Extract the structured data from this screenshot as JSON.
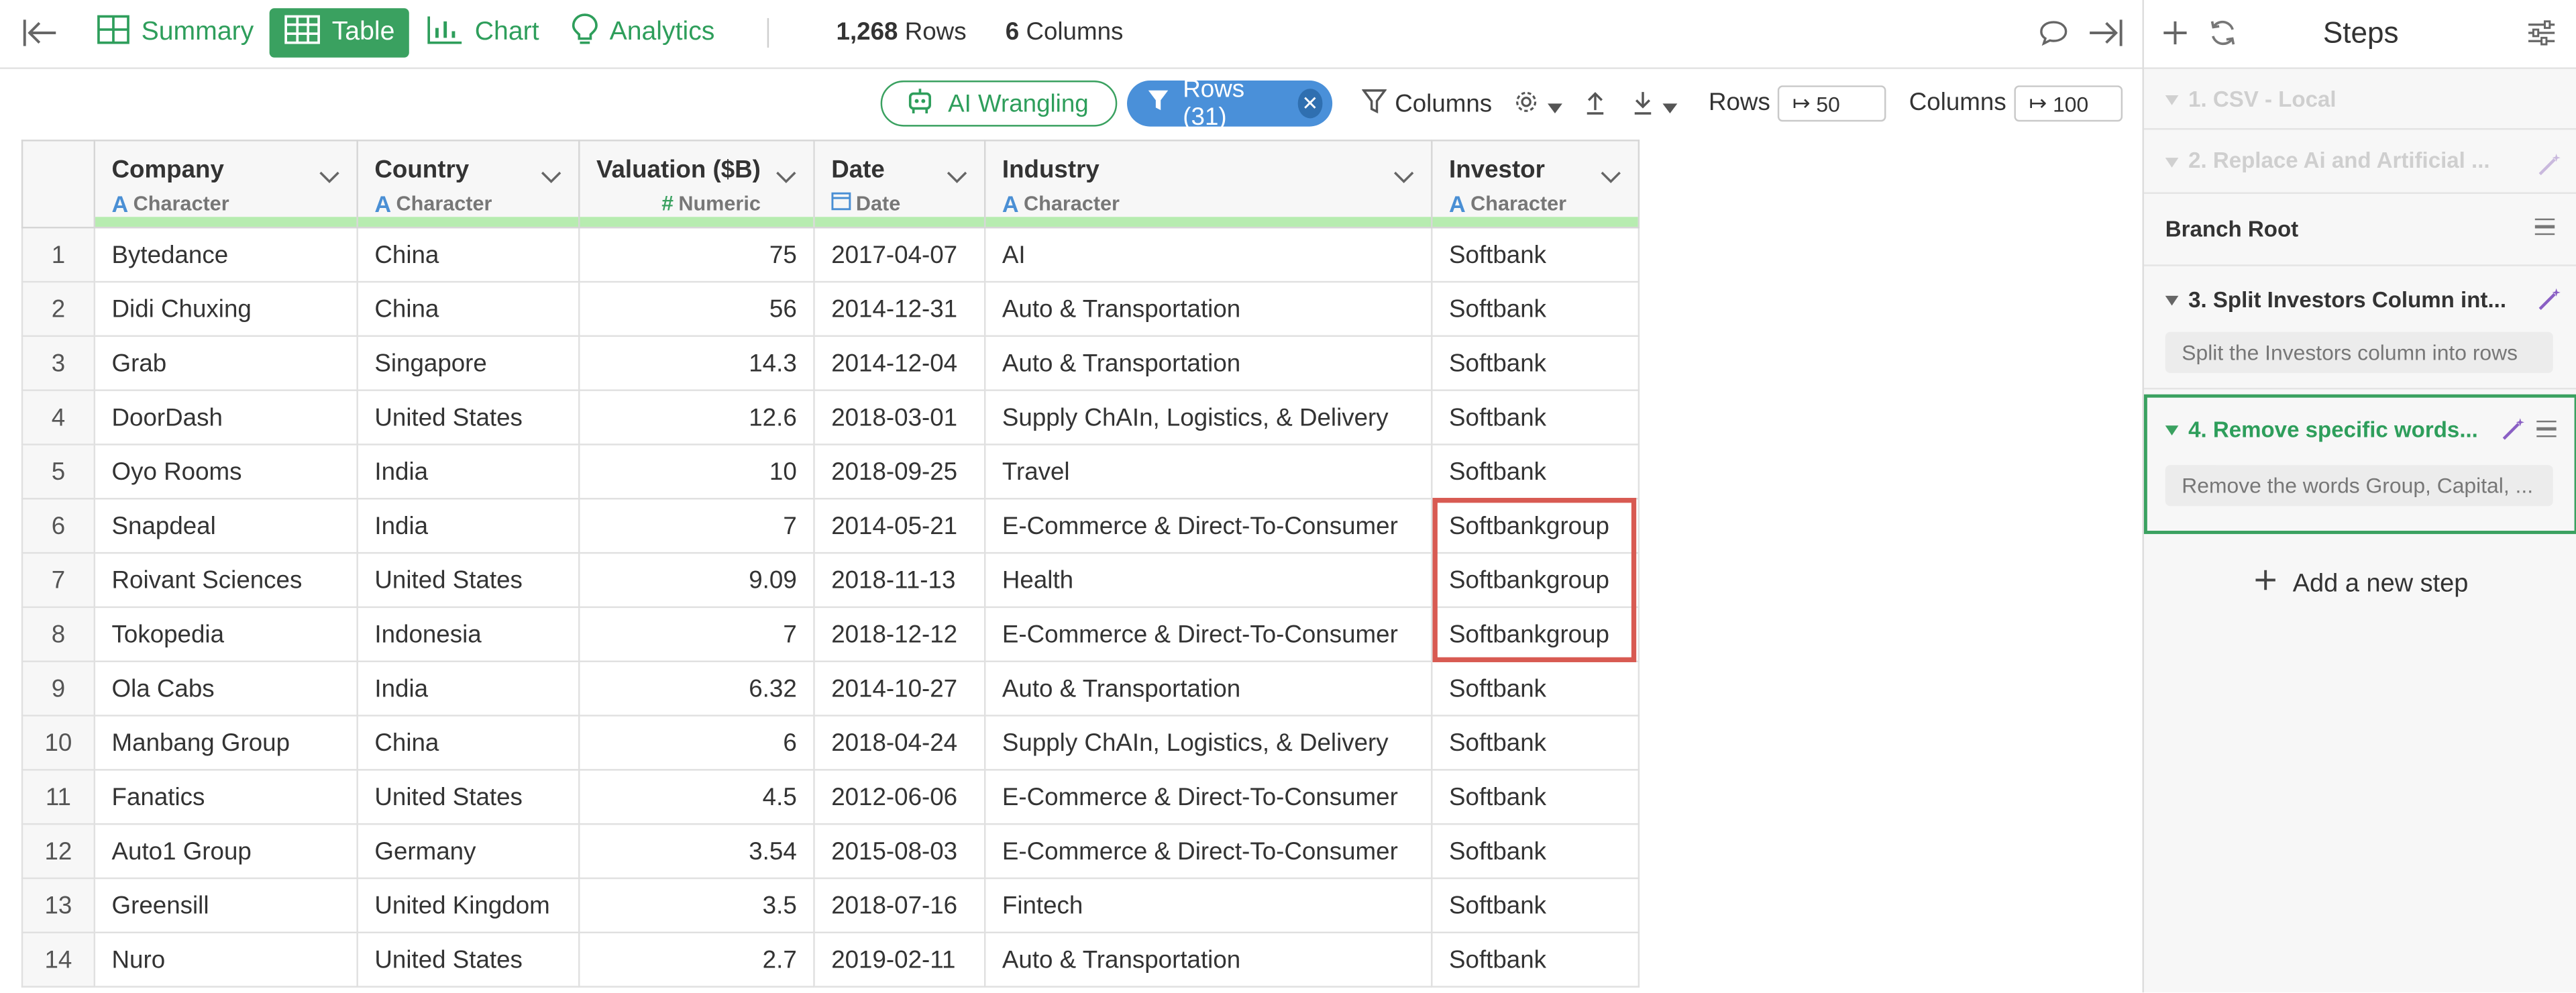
{
  "topbar": {
    "tabs": [
      {
        "label": "Summary",
        "icon": "summary-icon"
      },
      {
        "label": "Table",
        "icon": "table-icon",
        "active": true
      },
      {
        "label": "Chart",
        "icon": "chart-icon"
      },
      {
        "label": "Analytics",
        "icon": "lightbulb-icon"
      }
    ],
    "rows_count": "1,268",
    "rows_word": "Rows",
    "cols_count": "6",
    "cols_word": "Columns"
  },
  "toolbar": {
    "ai_wrangling": "AI Wrangling",
    "rows_filter": "Rows (31)",
    "columns": "Columns",
    "rows_label": "Rows",
    "rows_value": "50",
    "columns_label": "Columns",
    "columns_value": "100"
  },
  "table": {
    "columns": [
      {
        "name": "Company",
        "type": "Character",
        "type_icon": "A"
      },
      {
        "name": "Country",
        "type": "Character",
        "type_icon": "A"
      },
      {
        "name": "Valuation ($B)",
        "type": "Numeric",
        "type_icon": "#"
      },
      {
        "name": "Date",
        "type": "Date",
        "type_icon": "calendar"
      },
      {
        "name": "Industry",
        "type": "Character",
        "type_icon": "A"
      },
      {
        "name": "Investor",
        "type": "Character",
        "type_icon": "A"
      }
    ],
    "rows": [
      [
        "1",
        "Bytedance",
        "China",
        "75",
        "2017-04-07",
        "AI",
        "Softbank"
      ],
      [
        "2",
        "Didi Chuxing",
        "China",
        "56",
        "2014-12-31",
        "Auto & Transportation",
        "Softbank"
      ],
      [
        "3",
        "Grab",
        "Singapore",
        "14.3",
        "2014-12-04",
        "Auto & Transportation",
        "Softbank"
      ],
      [
        "4",
        "DoorDash",
        "United States",
        "12.6",
        "2018-03-01",
        "Supply ChAIn, Logistics, & Delivery",
        "Softbank"
      ],
      [
        "5",
        "Oyo Rooms",
        "India",
        "10",
        "2018-09-25",
        "Travel",
        "Softbank"
      ],
      [
        "6",
        "Snapdeal",
        "India",
        "7",
        "2014-05-21",
        "E-Commerce & Direct-To-Consumer",
        "Softbankgroup"
      ],
      [
        "7",
        "Roivant Sciences",
        "United States",
        "9.09",
        "2018-11-13",
        "Health",
        "Softbankgroup"
      ],
      [
        "8",
        "Tokopedia",
        "Indonesia",
        "7",
        "2018-12-12",
        "E-Commerce & Direct-To-Consumer",
        "Softbankgroup"
      ],
      [
        "9",
        "Ola Cabs",
        "India",
        "6.32",
        "2014-10-27",
        "Auto & Transportation",
        "Softbank"
      ],
      [
        "10",
        "Manbang Group",
        "China",
        "6",
        "2018-04-24",
        "Supply ChAIn, Logistics, & Delivery",
        "Softbank"
      ],
      [
        "11",
        "Fanatics",
        "United States",
        "4.5",
        "2012-06-06",
        "E-Commerce & Direct-To-Consumer",
        "Softbank"
      ],
      [
        "12",
        "Auto1 Group",
        "Germany",
        "3.54",
        "2015-08-03",
        "E-Commerce & Direct-To-Consumer",
        "Softbank"
      ],
      [
        "13",
        "Greensill",
        "United Kingdom",
        "3.5",
        "2018-07-16",
        "Fintech",
        "Softbank"
      ],
      [
        "14",
        "Nuro",
        "United States",
        "2.7",
        "2019-02-11",
        "Auto & Transportation",
        "Softbank"
      ]
    ]
  },
  "steps": {
    "title": "Steps",
    "items": [
      {
        "title": "1. CSV - Local"
      },
      {
        "title": "2. Replace Ai and Artificial ..."
      },
      {
        "title": "Branch Root"
      },
      {
        "title": "3. Split Investors Column int...",
        "desc": "Split the Investors column into rows"
      },
      {
        "title": "4. Remove specific words...",
        "desc": "Remove the words Group, Capital, ..."
      }
    ],
    "add_label": "Add a new step"
  },
  "colors": {
    "accent_green": "#3aa160",
    "filter_blue": "#4a90d9",
    "highlight_red": "#d85a52"
  }
}
